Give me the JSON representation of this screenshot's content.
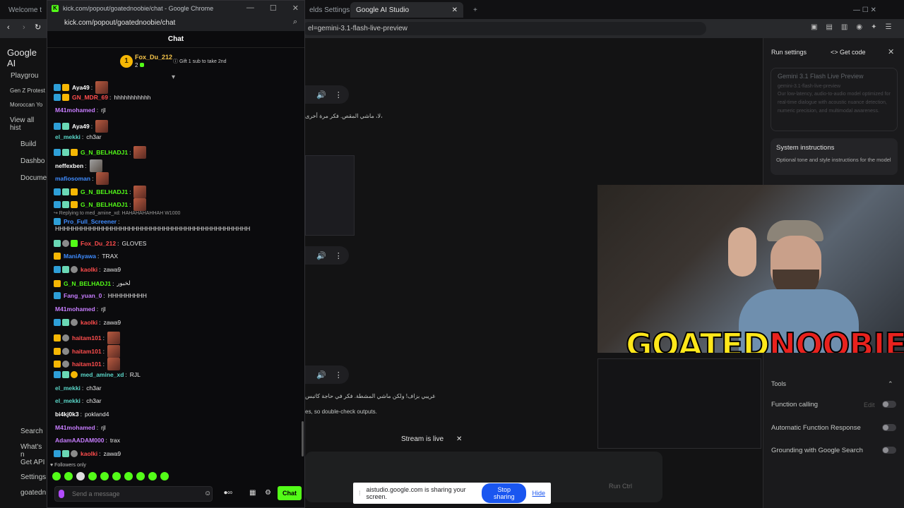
{
  "bg_browser": {
    "tabs": [
      {
        "label": "Welcome t"
      },
      {
        "label": "elds Settings"
      },
      {
        "label": "Google AI Studio"
      }
    ],
    "url_fragment": "el=gemini-3.1-flash-live-preview"
  },
  "studio": {
    "logo": "Google AI",
    "nav": [
      {
        "label": "Playgrou"
      },
      {
        "label": "Gen Z Protest"
      },
      {
        "label": "Moroccan Yo"
      },
      {
        "label": "View all hist"
      },
      {
        "label": "Build"
      },
      {
        "label": "Dashbo"
      },
      {
        "label": "Docume"
      },
      {
        "label": "Search"
      },
      {
        "label": "What's n"
      },
      {
        "label": "Get API"
      },
      {
        "label": "Settings"
      },
      {
        "label": "goatedn"
      }
    ],
    "arabic_line_1": "لا، ماشي المقص. فكر مرة أخرى،",
    "arabic_line_2": "غريبي بزاف! ولكن ماشي المشطة. فكر في حاجة كاتبس",
    "disclaimer": "es, so double-check outputs.",
    "stream_status": "Stream is live",
    "share_text": "aistudio.google.com is sharing your screen.",
    "stop_sharing": "Stop sharing",
    "hide": "Hide",
    "run_button": "Run Ctrl"
  },
  "run_settings": {
    "title": "Run settings",
    "get_code": "Get code",
    "model_name": "Gemini 3.1 Flash Live Preview",
    "model_id": "gemini-3.1-flash-live-preview",
    "model_desc": "Our low-latency, audio-to-audio model optimized for real-time dialogue with acoustic nuance detection, numeric precision, and multimodal awareness.",
    "system_instructions": "System instructions",
    "system_desc": "Optional tone and style instructions for the model",
    "tools": "Tools",
    "edit": "Edit",
    "function_calling": "Function calling",
    "auto_function": "Automatic Function Response",
    "grounding": "Grounding with Google Search"
  },
  "video": {
    "logo_a": "GOATED",
    "logo_b": "NOOBIE"
  },
  "popout": {
    "window_title": "kick.com/popout/goatednoobie/chat - Google Chrome",
    "url": "kick.com/popout/goatednoobie/chat",
    "chat_title": "Chat",
    "pinned": {
      "rank": "1",
      "name": "Fox_Du_212",
      "count": "2",
      "gift_note": "Gift 1 sub to take 2nd"
    },
    "followers_only": "Followers only",
    "input_placeholder": "Send a message",
    "send_label": "Chat",
    "reply_note": "Replying to med_amine_xd: HAHAHAHAHHAH W1000",
    "messages": [
      {
        "user": "Aya49",
        "color": "#ffffff",
        "text": "",
        "emote": true
      },
      {
        "user": "GN_MDR_69",
        "color": "#ff4d4d",
        "text": "hhhhhhhhhhh"
      },
      {
        "user": "M41mohamed",
        "color": "#c77dff",
        "text": "rjl"
      },
      {
        "user": "Aya49",
        "color": "#ffffff",
        "text": "",
        "emote": true
      },
      {
        "user": "el_mekki",
        "color": "#5ad6c8",
        "text": "ch3ar"
      },
      {
        "user": "G_N_BELHADJ1",
        "color": "#53fc18",
        "text": "",
        "emote": true
      },
      {
        "user": "neffexben",
        "color": "#ffffff",
        "text": "",
        "emote": true
      },
      {
        "user": "mafiosoman",
        "color": "#3f8cff",
        "text": "",
        "emote": true
      },
      {
        "user": "G_N_BELHADJ1",
        "color": "#53fc18",
        "text": "",
        "emote": true
      },
      {
        "user": "G_N_BELHADJ1",
        "color": "#53fc18",
        "text": "",
        "emote": true
      },
      {
        "user": "Pro_Full_Screener",
        "color": "#3f8cff",
        "text": ""
      },
      {
        "user": "",
        "color": "#ffffff",
        "text": "HHHHHHHHHHHHHHHHHHHHHHHHHHHHHHHHHHHHHHHHHHHHH"
      },
      {
        "user": "Fox_Du_212",
        "color": "#ff4d4d",
        "text": "GLOVES"
      },
      {
        "user": "ManiAyawa",
        "color": "#3f8cff",
        "text": "TRAX"
      },
      {
        "user": "kaolki",
        "color": "#ff4d4d",
        "text": "zawa9"
      },
      {
        "user": "G_N_BELHADJ1",
        "color": "#53fc18",
        "text": "لخبور"
      },
      {
        "user": "Fang_yuan_0",
        "color": "#c77dff",
        "text": "HHHHHHHHH"
      },
      {
        "user": "M41mohamed",
        "color": "#c77dff",
        "text": "rjl"
      },
      {
        "user": "kaolki",
        "color": "#ff4d4d",
        "text": "zawa9"
      },
      {
        "user": "haitam101",
        "color": "#ff4d4d",
        "text": "",
        "emote": true
      },
      {
        "user": "haitam101",
        "color": "#ff4d4d",
        "text": "",
        "emote": true
      },
      {
        "user": "haitam101",
        "color": "#ff4d4d",
        "text": "",
        "emote": true
      },
      {
        "user": "med_amine_xd",
        "color": "#5ad6c8",
        "text": "RJL"
      },
      {
        "user": "el_mekki",
        "color": "#5ad6c8",
        "text": "ch3ar"
      },
      {
        "user": "el_mekki",
        "color": "#5ad6c8",
        "text": "ch3ar"
      },
      {
        "user": "bi4kj0k3",
        "color": "#ffffff",
        "text": "pokland4"
      },
      {
        "user": "M41mohamed",
        "color": "#c77dff",
        "text": "rjl"
      },
      {
        "user": "AdamAADAM000",
        "color": "#c77dff",
        "text": "trax"
      },
      {
        "user": "kaolki",
        "color": "#ff4d4d",
        "text": "zawa9"
      }
    ]
  }
}
